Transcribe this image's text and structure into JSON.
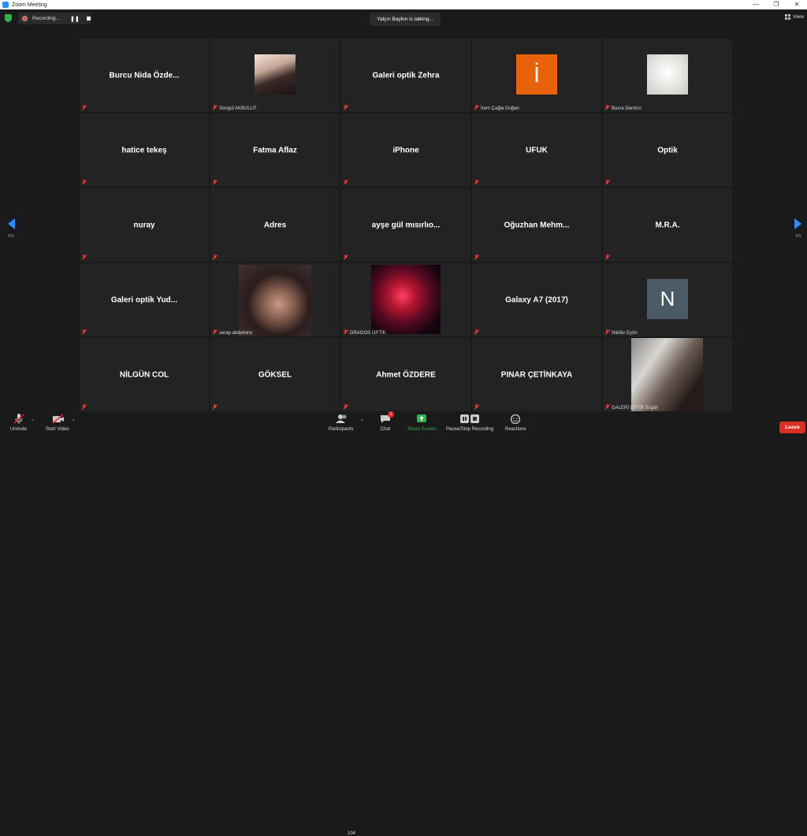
{
  "window": {
    "title": "Zoom Meeting",
    "controls": [
      "—",
      "❐",
      "✕"
    ]
  },
  "recording": {
    "label": "Recording...",
    "pause_glyph": "❚❚"
  },
  "talking": "Yalçın Baykın is talking...",
  "view_label": "View",
  "pagination": {
    "left": "5/5",
    "right": "5/5"
  },
  "tiles": [
    {
      "name": "Burcu Nida Özde...",
      "label": ""
    },
    {
      "name": "",
      "label": "Songül AKBULUT"
    },
    {
      "name": "Galeri optik Zehra",
      "label": ""
    },
    {
      "name": "",
      "label": "İrem Çağla Doğan",
      "initial": "İ",
      "initial_color": "#e8620c"
    },
    {
      "name": "",
      "label": "Busra Demirci"
    },
    {
      "name": "hatice tekeş",
      "label": ""
    },
    {
      "name": "Fatma Aflaz",
      "label": ""
    },
    {
      "name": "iPhone",
      "label": ""
    },
    {
      "name": "UFUK",
      "label": ""
    },
    {
      "name": "Optik",
      "label": ""
    },
    {
      "name": "nuray",
      "label": ""
    },
    {
      "name": "Adres",
      "label": ""
    },
    {
      "name": "ayşe gül mısırlıo...",
      "label": ""
    },
    {
      "name": "Oğuzhan  Mehm...",
      "label": ""
    },
    {
      "name": "M.R.A.",
      "label": ""
    },
    {
      "name": "Galeri optik Yud...",
      "label": ""
    },
    {
      "name": "",
      "label": "serap akdemirci"
    },
    {
      "name": "",
      "label": "DRAGOS OPTİK"
    },
    {
      "name": "Galaxy A7 (2017)",
      "label": ""
    },
    {
      "name": "",
      "label": "Nilüfer Eyön",
      "initial": "N",
      "initial_color": "#4a5a66"
    },
    {
      "name": "NİLGÜN COL",
      "label": ""
    },
    {
      "name": "GÖKSEL",
      "label": ""
    },
    {
      "name": "Ahmet ÖZDERE",
      "label": ""
    },
    {
      "name": "PINAR ÇETİNKAYA",
      "label": ""
    },
    {
      "name": "",
      "label": "GALERİ  OPTİK Ergün"
    }
  ],
  "toolbar": {
    "unmute": "Unmute",
    "start_video": "Start Video",
    "participants": "Participants",
    "participants_count": "104",
    "chat": "Chat",
    "chat_badge": "1",
    "share_screen": "Share Screen",
    "pause_stop_recording": "Pause/Stop Recording",
    "reactions": "Reactions",
    "leave": "Leave"
  },
  "colors": {
    "accent": "#2d8cff",
    "share": "#2fb14f",
    "leave": "#d93025"
  }
}
